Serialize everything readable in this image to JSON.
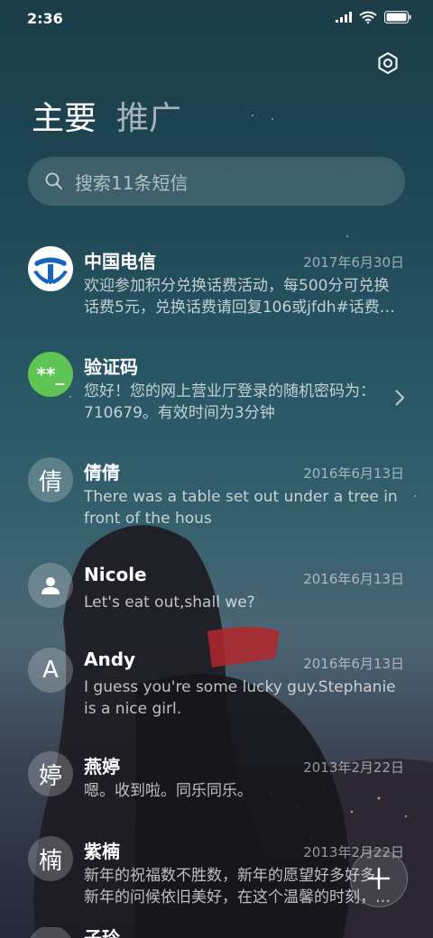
{
  "status_bar": {
    "time": "2:36",
    "icons": [
      "signal-icon",
      "wifi-icon",
      "battery-icon"
    ]
  },
  "settings_icon": "settings-icon",
  "tabs": [
    {
      "label": "主要",
      "active": true
    },
    {
      "label": "推广",
      "active": false
    }
  ],
  "search": {
    "placeholder": "搜索11条短信",
    "icon": "search-icon"
  },
  "conversations": [
    {
      "avatar_type": "logo",
      "avatar_icon": "china-telecom-logo",
      "name": "中国电信",
      "date": "2017年6月30日",
      "preview": "欢迎参加积分兑换话费活动，每500分可兑换\n话费5元，兑换话费请回复106或jfdh#话费…"
    },
    {
      "avatar_type": "code",
      "avatar_text": "**_",
      "name": "验证码",
      "date": "",
      "preview": "您好！您的网上营业厅登录的随机密码为：\n710679。有效时间为3分钟",
      "chevron": true
    },
    {
      "avatar_type": "char",
      "avatar_text": "倩",
      "name": "倩倩",
      "date": "2016年6月13日",
      "preview": "There was a table set out under a tree in\nfront of the hous"
    },
    {
      "avatar_type": "person",
      "avatar_icon": "person-icon",
      "name": "Nicole",
      "date": "2016年6月13日",
      "preview": "Let's eat out,shall we?"
    },
    {
      "avatar_type": "char",
      "avatar_text": "A",
      "name": "Andy",
      "date": "2016年6月13日",
      "preview": "I guess you're some lucky guy.Stephanie\nis a nice girl."
    },
    {
      "avatar_type": "char",
      "avatar_text": "婷",
      "name": "燕婷",
      "date": "2013年2月22日",
      "preview": "嗯。收到啦。同乐同乐。"
    },
    {
      "avatar_type": "char",
      "avatar_text": "楠",
      "name": "紫楠",
      "date": "2013年2月22日",
      "preview": "新年的祝福数不胜数，新年的愿望好多好多，\n新年的问候依旧美好，在这个温馨的时刻，…"
    },
    {
      "avatar_type": "char",
      "avatar_text": "",
      "name": "子玲",
      "date": "",
      "preview": ""
    }
  ],
  "fab": {
    "icon": "plus-icon"
  },
  "colors": {
    "verification_avatar": "#5ec454",
    "telecom_blue": "#1565c0"
  }
}
